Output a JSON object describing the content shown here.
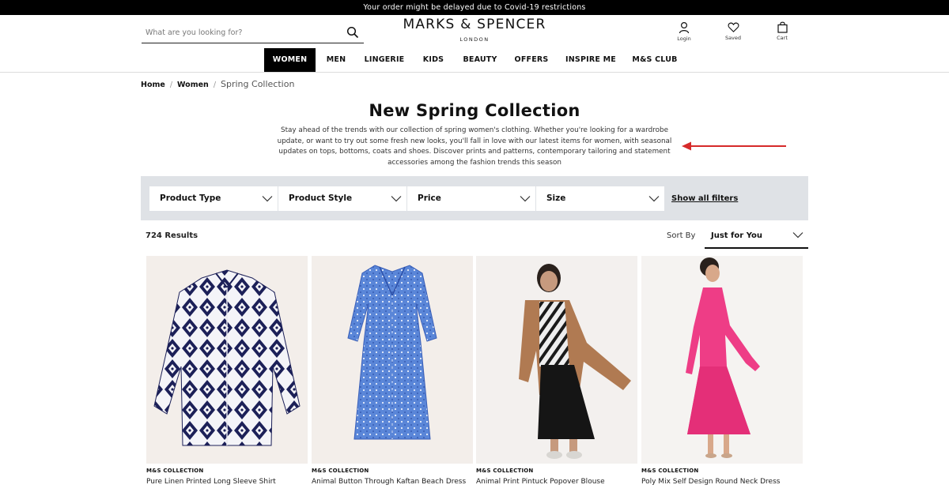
{
  "banner": {
    "text": "Your order might be delayed due to Covid-19 restrictions"
  },
  "search": {
    "placeholder": "What are you looking for?"
  },
  "logo": {
    "brand": "MARKS & SPENCER",
    "sub": "LONDON"
  },
  "utility": {
    "login": "Login",
    "saved": "Saved",
    "cart": "Cart"
  },
  "nav": {
    "items": [
      {
        "label": "WOMEN"
      },
      {
        "label": "MEN"
      },
      {
        "label": "LINGERIE"
      },
      {
        "label": "KIDS"
      },
      {
        "label": "BEAUTY"
      },
      {
        "label": "OFFERS"
      },
      {
        "label": "INSPIRE ME"
      },
      {
        "label": "M&S CLUB"
      }
    ]
  },
  "breadcrumb": {
    "home": "Home",
    "women": "Women",
    "current": "Spring Collection",
    "separator": "/"
  },
  "page": {
    "title": "New Spring Collection",
    "intro": "Stay ahead of the trends with our collection of spring women's clothing. Whether you're looking for a wardrobe update, or want to try out some fresh new looks, you'll fall in love with our latest items for women, with seasonal updates on tops, bottoms, coats and shoes. Discover prints and patterns, contemporary tailoring and statement accessories among the fashion trends this season"
  },
  "filters": {
    "items": [
      {
        "label": "Product Type"
      },
      {
        "label": "Product Style"
      },
      {
        "label": "Price"
      },
      {
        "label": "Size"
      }
    ],
    "show_all": "Show all filters"
  },
  "results": {
    "count_text": "724 Results"
  },
  "sort": {
    "label": "Sort By",
    "value": "Just for You"
  },
  "products": [
    {
      "brand": "M&S COLLECTION",
      "name": "Pure Linen Printed Long Sleeve Shirt"
    },
    {
      "brand": "M&S COLLECTION",
      "name": "Animal Button Through Kaftan Beach Dress"
    },
    {
      "brand": "M&S COLLECTION",
      "name": "Animal Print Pintuck Popover Blouse"
    },
    {
      "brand": "M&S COLLECTION",
      "name": "Poly Mix Self Design Round Neck Dress"
    }
  ],
  "colors": {
    "banner_bg": "#000000",
    "filter_bar_bg": "#dfe2e6",
    "annotation_arrow": "#d62a2a",
    "nav_active_bg": "#000000"
  }
}
